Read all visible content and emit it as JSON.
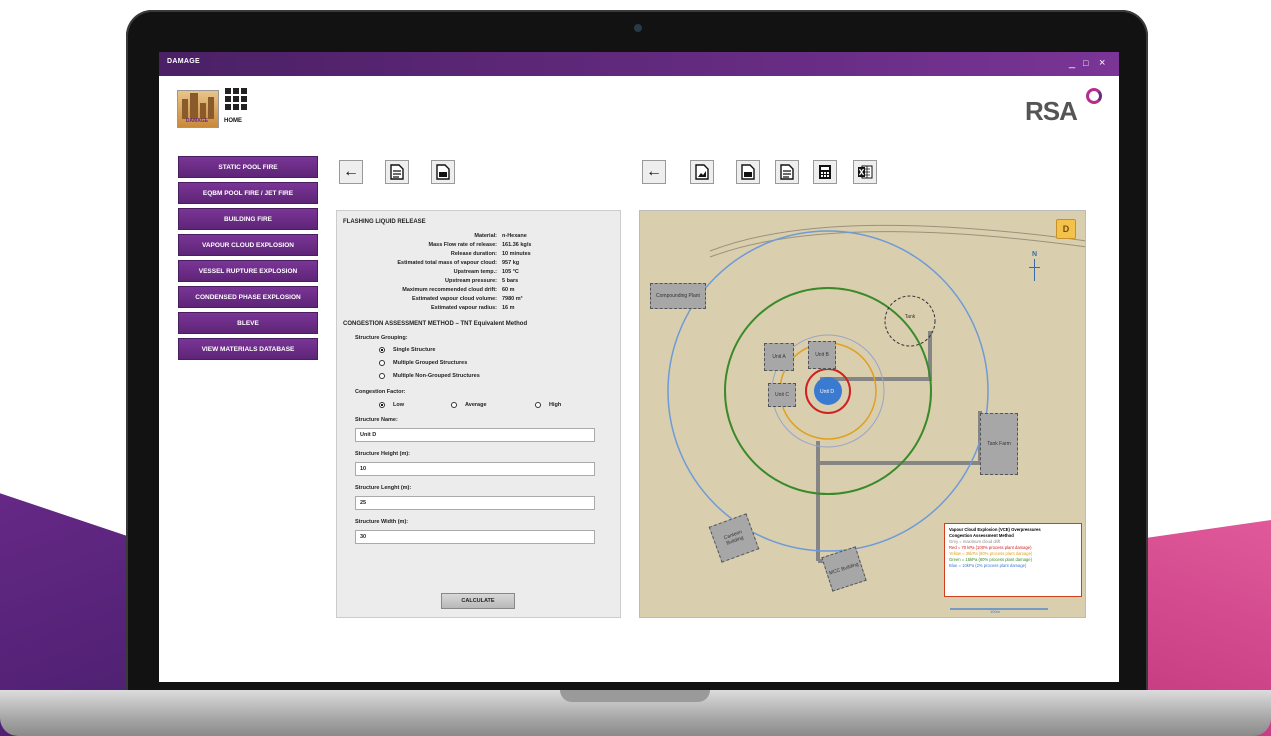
{
  "window": {
    "title": "DAMAGE",
    "minimize": "_",
    "maximize": "□",
    "close": "×"
  },
  "header": {
    "logo_label": "DAMAGE",
    "home_label": "HOME",
    "brand": "RSA"
  },
  "sidebar": {
    "items": [
      {
        "label": "STATIC POOL FIRE"
      },
      {
        "label": "EQBM POOL FIRE / JET FIRE"
      },
      {
        "label": "BUILDING FIRE"
      },
      {
        "label": "VAPOUR CLOUD EXPLOSION"
      },
      {
        "label": "VESSEL RUPTURE EXPLOSION"
      },
      {
        "label": "CONDENSED PHASE EXPLOSION"
      },
      {
        "label": "BLEVE"
      },
      {
        "label": "VIEW MATERIALS DATABASE"
      }
    ]
  },
  "toolbar_left": {
    "icons": [
      "back-arrow-icon",
      "document-icon",
      "pdf-icon"
    ]
  },
  "toolbar_right": {
    "icons": [
      "back-arrow-icon",
      "image-icon",
      "pdf-icon",
      "document-icon",
      "calculator-icon",
      "excel-icon"
    ]
  },
  "form": {
    "section_title": "FLASHING LIQUID RELEASE",
    "properties": [
      {
        "key": "Material:",
        "value": "n-Hexane"
      },
      {
        "key": "Mass Flow rate of release:",
        "value": "161.36 kg/s"
      },
      {
        "key": "Release duration:",
        "value": "10 minutes"
      },
      {
        "key": "Estimated total mass of vapour cloud:",
        "value": "957 kg"
      },
      {
        "key": "Upstream temp.:",
        "value": "105 °C"
      },
      {
        "key": "Upstream pressure:",
        "value": "5 bars"
      },
      {
        "key": "Maximum recommended cloud drift:",
        "value": "60 m"
      },
      {
        "key": "Estimated vapour cloud volume:",
        "value": "7980 m³"
      },
      {
        "key": "Estimated vapour radius:",
        "value": "16 m"
      }
    ],
    "method_title": "CONGESTION ASSESSMENT METHOD – TNT Equivalent Method",
    "grouping_label": "Structure Grouping:",
    "grouping_options": [
      {
        "label": "Single Structure",
        "selected": true
      },
      {
        "label": "Multiple Grouped Structures",
        "selected": false
      },
      {
        "label": "Multiple Non-Grouped Structures",
        "selected": false
      }
    ],
    "congestion_label": "Congestion Factor:",
    "congestion_options": [
      {
        "label": "Low",
        "selected": true
      },
      {
        "label": "Average",
        "selected": false
      },
      {
        "label": "High",
        "selected": false
      }
    ],
    "fields": [
      {
        "label": "Structure Name:",
        "value": "Unit D"
      },
      {
        "label": "Structure Height (m):",
        "value": "10"
      },
      {
        "label": "Structure Lenght (m):",
        "value": "25"
      },
      {
        "label": "Structure Width (m):",
        "value": "30"
      }
    ],
    "calculate_label": "CALCULATE"
  },
  "map": {
    "d_badge": "D",
    "north_label": "N",
    "buildings": [
      {
        "label": "Compounding Plant"
      },
      {
        "label": "Unit A"
      },
      {
        "label": "Unit B"
      },
      {
        "label": "Unit C"
      },
      {
        "label": "Unit D"
      },
      {
        "label": "Tank Farm"
      },
      {
        "label": "Canteen Building"
      },
      {
        "label": "MCC Building"
      },
      {
        "label": "Tank"
      }
    ],
    "legend": {
      "title": "Vapour Cloud Explosion (VCE) Overpressures",
      "subtitle": "Congestion Assessment Method",
      "lines": [
        {
          "text": "Grey = maximum cloud drift",
          "color": "#8a8a8a"
        },
        {
          "text": "Red = 70 kPa (100% process plant damage)",
          "color": "#d02020"
        },
        {
          "text": "Yellow = 35kPa (80% process plant damage)",
          "color": "#e0a020"
        },
        {
          "text": "Green = 15kPa (60% process plant damage)",
          "color": "#3a8a2a"
        },
        {
          "text": "Blue = 10kPa (2% process plant damage)",
          "color": "#3a7ad0"
        }
      ],
      "scale": "100m"
    }
  },
  "colors": {
    "accent_purple": "#6a2d86",
    "brand_pink": "#b52e8e"
  }
}
